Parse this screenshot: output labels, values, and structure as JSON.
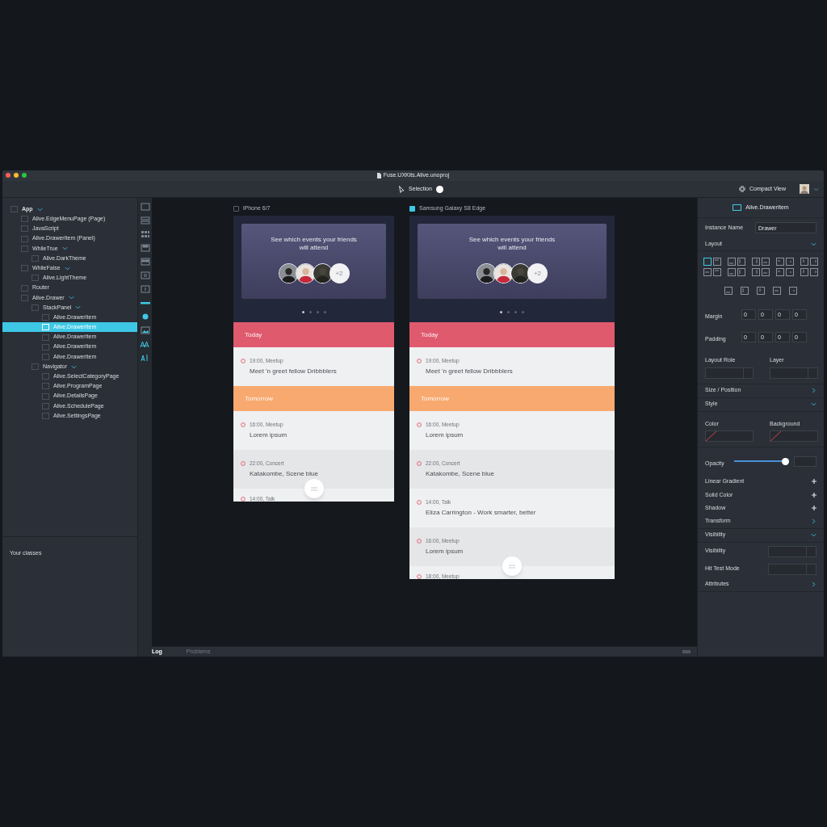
{
  "window": {
    "title": "Fuse.UXKits.Alive.unoproj"
  },
  "toolbar": {
    "mode": "Selection",
    "view": "Compact View"
  },
  "tree": [
    {
      "label": "App",
      "expanded": true,
      "selected": false,
      "children": [
        {
          "label": "Alive.EdgeMenuPage (Page)",
          "selected": false
        },
        {
          "label": "JavaScript",
          "selected": false
        },
        {
          "label": "Alive.DrawerItem (Panel)",
          "selected": false
        },
        {
          "label": "WhileTrue",
          "expanded": true,
          "selected": false,
          "children": [
            {
              "label": "Alive.DarkTheme",
              "selected": false
            }
          ]
        },
        {
          "label": "WhileFalse",
          "expanded": true,
          "selected": false,
          "children": [
            {
              "label": "Alive.LightTheme",
              "selected": false
            }
          ]
        },
        {
          "label": "Router",
          "selected": false
        },
        {
          "label": "Alive.Drawer",
          "expanded": true,
          "selected": false,
          "children": [
            {
              "label": "StackPanel",
              "expanded": true,
              "selected": false,
              "children": [
                {
                  "label": "Alive.DrawerItem",
                  "selected": false
                },
                {
                  "label": "Alive.DrawerItem",
                  "selected": true
                },
                {
                  "label": "Alive.DrawerItem",
                  "selected": false
                },
                {
                  "label": "Alive.DrawerItem",
                  "selected": false
                },
                {
                  "label": "Alive.DrawerItem",
                  "selected": false
                }
              ]
            },
            {
              "label": "Navigator",
              "expanded": true,
              "selected": false,
              "children": [
                {
                  "label": "Alive.SelectCategoryPage",
                  "selected": false
                },
                {
                  "label": "Alive.ProgramPage",
                  "selected": false
                },
                {
                  "label": "Alive.DetailsPage",
                  "selected": false
                },
                {
                  "label": "Alive.SchedulePage",
                  "selected": false
                },
                {
                  "label": "Alive.SettingsPage",
                  "selected": false
                }
              ]
            }
          ]
        }
      ]
    }
  ],
  "classes_panel": {
    "title": "Your classes"
  },
  "devices": [
    {
      "label": "iPhone 6/7",
      "selected": false,
      "card": {
        "text": "See which events your friends will attend",
        "more": "+2"
      },
      "pages": [
        {
          "selected": true
        },
        {
          "selected": false
        },
        {
          "selected": false
        },
        {
          "selected": false
        }
      ],
      "sections": [
        {
          "label": "Today",
          "color": "#e05a6e",
          "events": [
            {
              "time": "19:00, Meetup",
              "title": "Meet 'n greet fellow Dribbblers"
            }
          ]
        },
        {
          "label": "Tomorrow",
          "color": "#f7a96f",
          "events": [
            {
              "time": "16:00, Meetup",
              "title": "Lorem ipsum"
            },
            {
              "time": "22:00, Concert",
              "title": "Katakombe, Scene blue"
            },
            {
              "time": "14:00, Talk"
            }
          ]
        }
      ]
    },
    {
      "label": "Samsung Galaxy S8 Edge",
      "selected": true,
      "card": {
        "text": "See which events your friends will attend",
        "more": "+2"
      },
      "pages": [
        {
          "selected": true
        },
        {
          "selected": false
        },
        {
          "selected": false
        },
        {
          "selected": false
        }
      ],
      "sections": [
        {
          "label": "Today",
          "color": "#e05a6e",
          "events": [
            {
              "time": "19:00, Meetup",
              "title": "Meet 'n greet fellow Dribbblers"
            }
          ]
        },
        {
          "label": "Tomorrow",
          "color": "#f7a96f",
          "events": [
            {
              "time": "16:00, Meetup",
              "title": "Lorem ipsum"
            },
            {
              "time": "22:00, Concert",
              "title": "Katakombe, Scene blue"
            },
            {
              "time": "14:00, Talk",
              "title": "Eliza Carrington - Work smarter, better"
            },
            {
              "time": "16:00, Meetup",
              "title": "Lorem ipsum"
            },
            {
              "time": "18:00, Meetup"
            }
          ]
        }
      ]
    }
  ],
  "inspector": {
    "title": "Alive.DrawerItem",
    "rows": [
      {
        "kind": "text_field",
        "label": "Instance Name",
        "value": "Drawer"
      },
      {
        "kind": "section",
        "label": "Layout",
        "expanded": true
      },
      {
        "kind": "alignment",
        "options": [
          {
            "selected": true
          },
          {
            "selected": false
          },
          {
            "selected": false
          },
          {
            "selected": false
          },
          {
            "selected": false
          },
          {
            "selected": false
          },
          {
            "selected": false
          },
          {
            "selected": false
          },
          {
            "selected": false
          },
          {
            "selected": false
          },
          {
            "selected": false
          },
          {
            "selected": false
          },
          {
            "selected": false
          },
          {
            "selected": false
          },
          {
            "selected": false
          },
          {
            "selected": false
          },
          {
            "selected": false
          },
          {
            "selected": false
          },
          {
            "selected": false
          },
          {
            "selected": false
          }
        ]
      },
      {
        "kind": "quad",
        "label": "Margin",
        "values": [
          "0",
          "0",
          "0",
          "0"
        ]
      },
      {
        "kind": "quad",
        "label": "Padding",
        "values": [
          "0",
          "0",
          "0",
          "0"
        ]
      },
      {
        "kind": "dropdown_pair",
        "labels": [
          "Layout Role",
          "Layer"
        ]
      },
      {
        "kind": "section",
        "label": "Size / Position",
        "expanded": false
      },
      {
        "kind": "section",
        "label": "Style",
        "expanded": true
      },
      {
        "kind": "swatch_pair",
        "labels": [
          "Color",
          "Background"
        ]
      },
      {
        "kind": "slider",
        "label": "Opacity",
        "level": 1
      },
      {
        "kind": "add",
        "label": "Linear Gradient"
      },
      {
        "kind": "add",
        "label": "Solid Color"
      },
      {
        "kind": "add",
        "label": "Shadow"
      },
      {
        "kind": "section",
        "label": "Transform",
        "expanded": false
      },
      {
        "kind": "section",
        "label": "Visibility",
        "expanded": true
      },
      {
        "kind": "dropdown",
        "label": "Visibility"
      },
      {
        "kind": "dropdown",
        "label": "Hit Test Mode"
      },
      {
        "kind": "section",
        "label": "Attributes",
        "expanded": false
      }
    ]
  },
  "bottom_tabs": [
    {
      "label": "Log",
      "selected": true
    },
    {
      "label": "Problems",
      "selected": false
    }
  ]
}
